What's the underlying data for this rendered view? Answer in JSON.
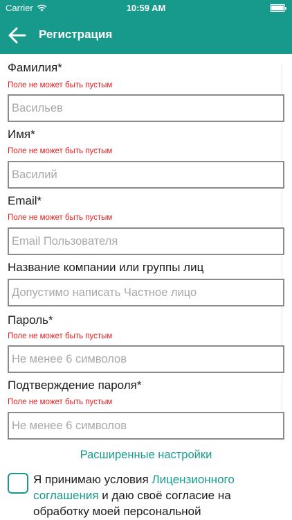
{
  "status_bar": {
    "carrier": "Carrier",
    "time": "10:59 AM"
  },
  "nav": {
    "title": "Регистрация",
    "back_icon": "arrow-left-icon"
  },
  "colors": {
    "accent": "#179a8c",
    "error": "#e02020",
    "input_border": "#8a8a8a"
  },
  "form": {
    "fields": [
      {
        "label": "Фамилия*",
        "error": "Поле не может быть пустым",
        "value": "",
        "placeholder": "Васильев"
      },
      {
        "label": "Имя*",
        "error": "Поле не может быть пустым",
        "value": "",
        "placeholder": "Василий"
      },
      {
        "label": "Email*",
        "error": "Поле не может быть пустым",
        "value": "",
        "placeholder": "Email Пользователя"
      },
      {
        "label": "Название компании или группы лиц",
        "value": "",
        "placeholder": "Допустимо написать Частное лицо"
      },
      {
        "label": "Пароль*",
        "error": "Поле не может быть пустым",
        "value": "",
        "placeholder": "Не менее 6 символов"
      },
      {
        "label": "Подтверждение пароля*",
        "error": "Поле не может быть пустым",
        "value": "",
        "placeholder": "Не менее 6 символов"
      }
    ],
    "advanced_link": "Расширенные настройки"
  },
  "agreement": {
    "text_before": "Я принимаю условия ",
    "link": "Лицензионного соглашения",
    "text_after": " и даю своё согласие на обработку моей персональной",
    "checked": false
  }
}
